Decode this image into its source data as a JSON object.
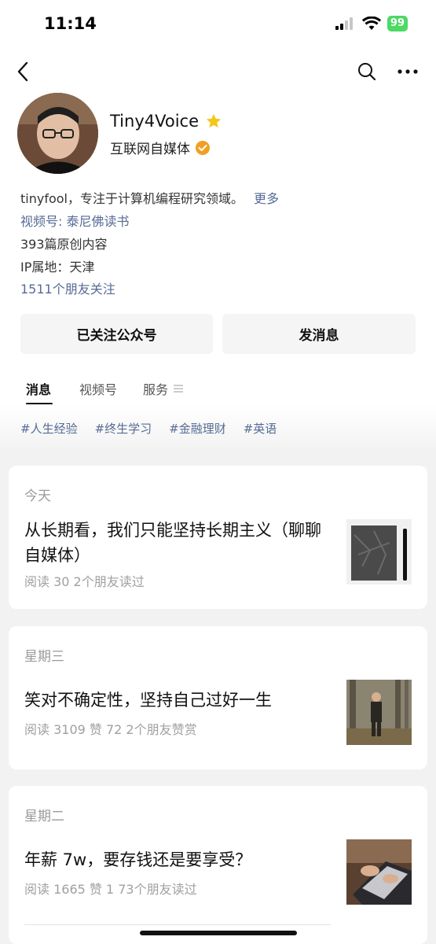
{
  "status_bar": {
    "time": "11:14",
    "battery": "99"
  },
  "nav": {
    "back_icon": "back-arrow-icon",
    "search_icon": "search-icon",
    "more_icon": "more-icon"
  },
  "profile": {
    "name": "Tiny4Voice",
    "subtitle": "互联网自媒体",
    "bio": "tinyfool，专注于计算机编程研究领域。",
    "bio_more": "更多",
    "channel": "视频号: 泰尼佛读书",
    "original_count": "393篇原创内容",
    "ip": "IP属地：天津",
    "friends_follow": "1511个朋友关注"
  },
  "buttons": {
    "followed": "已关注公众号",
    "message": "发消息"
  },
  "tabs": [
    {
      "label": "消息"
    },
    {
      "label": "视频号"
    },
    {
      "label": "服务"
    }
  ],
  "tags": [
    "#人生经验",
    "#终生学习",
    "#金融理财",
    "#英语"
  ],
  "articles": [
    {
      "day": "今天",
      "title": "从长期看，我们只能坚持长期主义（聊聊自媒体）",
      "meta": "阅读 30   2个朋友读过"
    },
    {
      "day": "星期三",
      "title": "笑对不确定性，坚持自己过好一生",
      "meta": "阅读 3109   赞 72   2个朋友赞赏"
    },
    {
      "day": "星期二",
      "title": "年薪 7w，要存钱还是要享受？",
      "meta": "阅读 1665   赞 1   73个朋友读过"
    }
  ],
  "colors": {
    "link": "#576b95",
    "verified": "#f0a020",
    "star": "#f5c518",
    "battery": "#4cd964"
  }
}
